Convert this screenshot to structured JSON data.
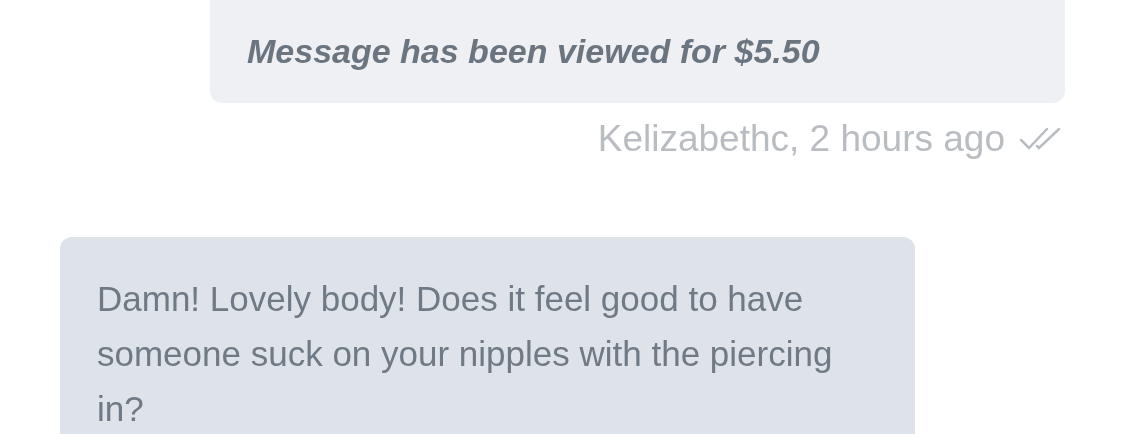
{
  "sent_message": {
    "text": "Message has been viewed for $5.50",
    "meta": "Kelizabethc, 2 hours ago",
    "read": true
  },
  "received_message": {
    "text": "Damn! Lovely body! Does it feel good to have someone suck on your nipples with the piercing in?"
  }
}
